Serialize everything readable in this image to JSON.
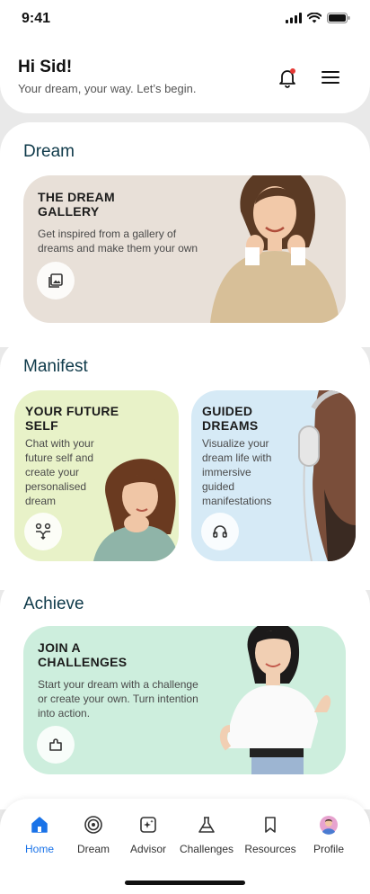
{
  "status_bar": {
    "time": "9:41"
  },
  "header": {
    "greeting": "Hi Sid!",
    "subtitle": "Your dream, your way. Let’s begin."
  },
  "dream_section": {
    "title": "Dream",
    "card": {
      "title": "THE DREAM GALLERY",
      "description": "Get inspired from a gallery of dreams and make them your own",
      "icon": "gallery-icon",
      "color": "#e8e0d8"
    }
  },
  "manifest_section": {
    "title": "Manifest",
    "cards": [
      {
        "title": "YOUR FUTURE SELF",
        "description": "Chat with your future self and create your personalised dream",
        "icon": "people-merge-icon",
        "color": "#e8f2c8"
      },
      {
        "title": "GUIDED DREAMS",
        "description": "Visualize your dream life with immersive guided manifestations",
        "icon": "headphones-icon",
        "color": "#d6eaf6"
      }
    ]
  },
  "achieve_section": {
    "title": "Achieve",
    "card": {
      "title": "JOIN A CHALLENGES",
      "description": "Start your dream with a challenge or create your own. Turn intention into action.",
      "icon": "puzzle-icon",
      "color": "#cdeedd"
    }
  },
  "bottom_nav": {
    "active_color": "#1a73e8",
    "items": [
      {
        "label": "Home",
        "icon": "home-icon",
        "active": true
      },
      {
        "label": "Dream",
        "icon": "target-icon",
        "active": false
      },
      {
        "label": "Advisor",
        "icon": "sparkle-box-icon",
        "active": false
      },
      {
        "label": "Challenges",
        "icon": "flask-icon",
        "active": false
      },
      {
        "label": "Resources",
        "icon": "bookmark-icon",
        "active": false
      },
      {
        "label": "Profile",
        "icon": "avatar-icon",
        "active": false
      }
    ]
  }
}
